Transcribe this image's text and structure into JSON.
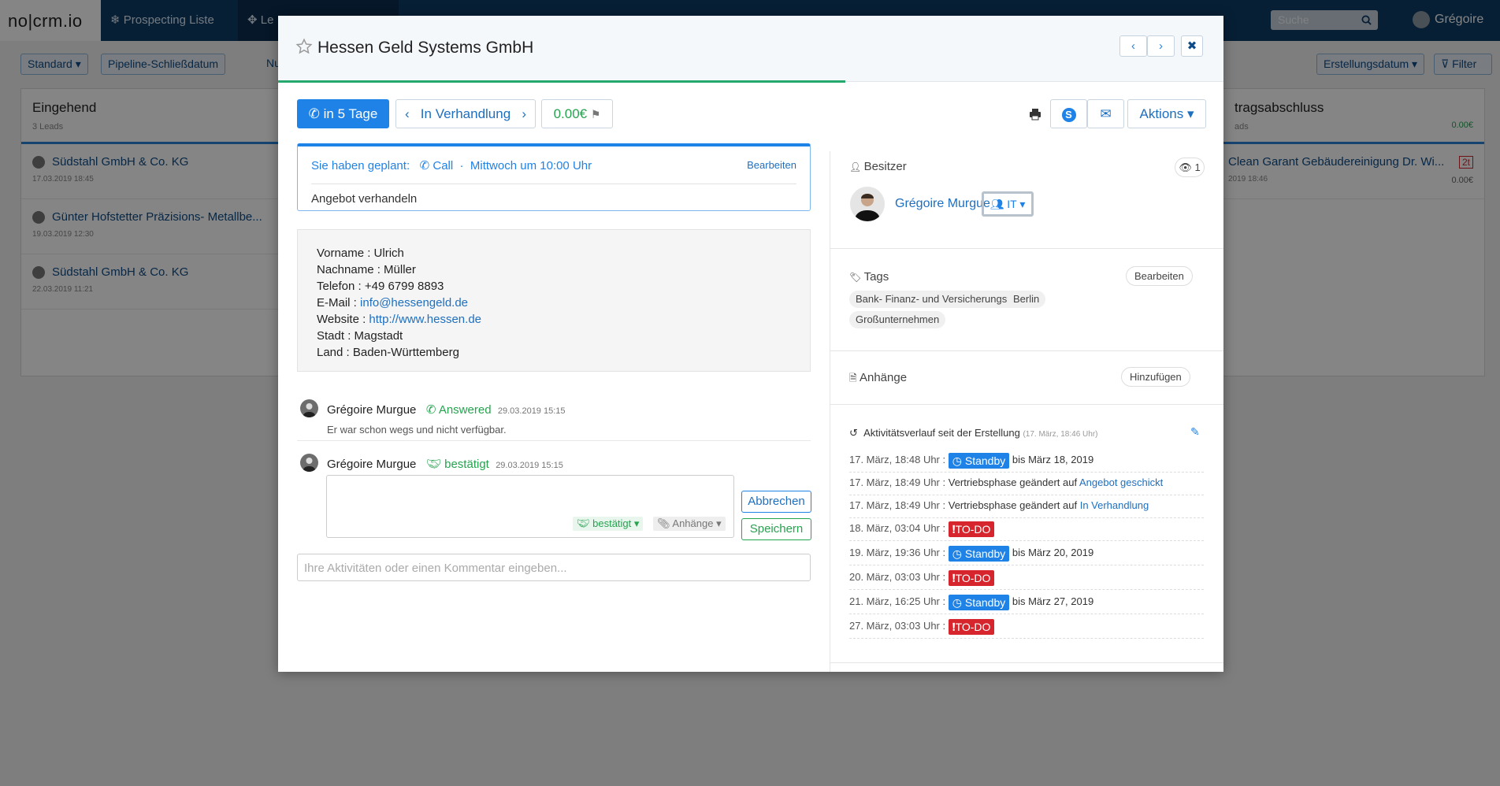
{
  "app": {
    "logo": "no|crm.io",
    "nav": [
      "Prospecting Liste",
      "Le"
    ],
    "search_placeholder": "Suche",
    "user_name": "Grégoire"
  },
  "toolbar": {
    "view": "Standard",
    "pipeline": "Pipeline-Schließdatum",
    "toggle_label": "Nu",
    "sort": "Erstellungsdatum",
    "filter": "Filter"
  },
  "pipeline": {
    "incoming": {
      "title": "Eingehend",
      "count": "3 Leads",
      "leads": [
        {
          "name": "Südstahl GmbH & Co. KG",
          "date": "17.03.2019 18:45"
        },
        {
          "name": "Günter Hofstetter Präzisions- Metallbe...",
          "date": "19.03.2019 12:30"
        },
        {
          "name": "Südstahl GmbH & Co. KG",
          "date": "22.03.2019 11:21"
        }
      ]
    },
    "closing": {
      "title": "tragsabschluss",
      "count": "ads",
      "amount": "0.00€",
      "lead": {
        "name": "Clean Garant Gebäudereinigung Dr. Wi...",
        "date": "2019 18:46",
        "badge": "2t",
        "amount": "0.00€"
      }
    }
  },
  "modal": {
    "title": "Hessen Geld Systems GmbH",
    "call_button": "in 5 Tage",
    "step": "In Verhandlung",
    "amount": "0.00€",
    "actions": "Aktions",
    "planned": {
      "prefix": "Sie haben geplant:",
      "type": "Call",
      "when": "Mittwoch um 10:00 Uhr",
      "edit": "Bearbeiten",
      "description": "Angebot verhandeln"
    },
    "contact": {
      "first_name": "Vorname : Ulrich",
      "last_name": "Nachname : Müller",
      "phone": "Telefon : +49 6799 8893",
      "email_label": "E-Mail : ",
      "email": "info@hessengeld.de",
      "website_label": "Website : ",
      "website": "http://www.hessen.de",
      "city": "Stadt : Magstadt",
      "country": "Land : Baden-Württemberg"
    },
    "activities": [
      {
        "user": "Grégoire Murgue",
        "status": "Answered",
        "time": "29.03.2019 15:15",
        "text": "Er war schon wegs und nicht verfügbar."
      },
      {
        "user": "Grégoire Murgue",
        "status": "bestätigt",
        "time": "29.03.2019 15:15"
      }
    ],
    "editor": {
      "status_chip": "bestätigt",
      "attach_chip": "Anhänge",
      "cancel": "Abbrechen",
      "save": "Speichern"
    },
    "comment_placeholder": "Ihre Aktivitäten oder einen Kommentar eingeben...",
    "owner": {
      "label": "Besitzer",
      "name": "Grégoire Murgue",
      "team": "IT",
      "watchers": "1"
    },
    "tags": {
      "label": "Tags",
      "edit": "Bearbeiten",
      "items": [
        "Bank- Finanz- und Versicherungswesen",
        "Berlin",
        "Großunternehmen"
      ]
    },
    "attachments": {
      "label": "Anhänge",
      "add": "Hinzufügen"
    },
    "history": {
      "title": "Aktivitätsverlauf seit der Erstellung",
      "since": "(17. März, 18:46 Uhr)",
      "entries": [
        {
          "date": "17. März, 18:48 Uhr :",
          "badge": "Standby",
          "text": "bis März 18, 2019"
        },
        {
          "date": "17. März, 18:49 Uhr :",
          "text": "Vertriebsphase geändert auf",
          "link": "Angebot geschickt"
        },
        {
          "date": "17. März, 18:49 Uhr :",
          "text": "Vertriebsphase geändert auf",
          "link": "In Verhandlung"
        },
        {
          "date": "18. März, 03:04 Uhr :",
          "badge": "TO-DO"
        },
        {
          "date": "19. März, 19:36 Uhr :",
          "badge": "Standby",
          "text": "bis März 20, 2019"
        },
        {
          "date": "20. März, 03:03 Uhr :",
          "badge": "TO-DO"
        },
        {
          "date": "21. März, 16:25 Uhr :",
          "badge": "Standby",
          "text": "bis März 27, 2019"
        },
        {
          "date": "27. März, 03:03 Uhr :",
          "badge": "TO-DO"
        }
      ]
    }
  }
}
